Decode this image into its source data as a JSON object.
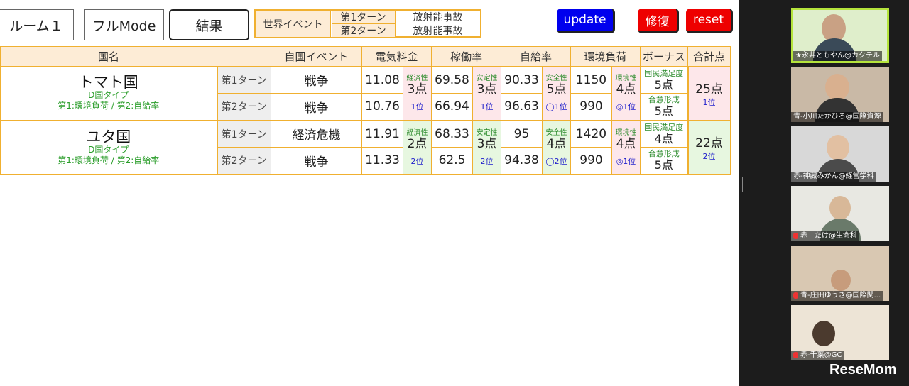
{
  "toolbar": {
    "room_label": "ルーム１",
    "mode_label": "フルMode",
    "result_label": "結果",
    "world_label": "世界イベント",
    "world_turns": [
      {
        "turn": "第1ターン",
        "event": "放射能事故"
      },
      {
        "turn": "第2ターン",
        "event": "放射能事故"
      }
    ],
    "update_label": "update",
    "fix_label": "修復",
    "reset_label": "reset",
    "colors": {
      "update": "#0000ee",
      "fix": "#ee0000",
      "reset": "#ee0000",
      "border": "#f0b030"
    }
  },
  "table": {
    "headers": [
      "国名",
      "",
      "自国イベント",
      "電気料金",
      "稼働率",
      "自給率",
      "環境負荷",
      "ボーナス",
      "合計点"
    ],
    "countries": [
      {
        "name": "トマト国",
        "type": "D国タイプ",
        "priority": "第1:環境負荷 / 第2:自給率",
        "turns": [
          {
            "turn": "第1ターン",
            "event": "戦争",
            "price": "11.08",
            "rate": "69.58",
            "self": "90.33",
            "env": "1150"
          },
          {
            "turn": "第2ターン",
            "event": "戦争",
            "price": "10.76",
            "rate": "66.94",
            "self": "96.63",
            "env": "990"
          }
        ],
        "scores": {
          "price": {
            "title": "経済性",
            "points": "3点",
            "rank": "1位"
          },
          "rate": {
            "title": "安定性",
            "points": "3点",
            "rank": "1位"
          },
          "self": {
            "title": "安全性",
            "points": "5点",
            "rank": "◯1位"
          },
          "env": {
            "title": "環境性",
            "points": "4点",
            "rank": "◎1位"
          }
        },
        "bonus": [
          {
            "title": "国民満足度",
            "points": "5点"
          },
          {
            "title": "合意形成",
            "points": "5点"
          }
        ],
        "total": {
          "points": "25点",
          "rank": "1位"
        }
      },
      {
        "name": "ユタ国",
        "type": "D国タイプ",
        "priority": "第1:環境負荷 / 第2:自給率",
        "turns": [
          {
            "turn": "第1ターン",
            "event": "経済危機",
            "price": "11.91",
            "rate": "68.33",
            "self": "95",
            "env": "1420"
          },
          {
            "turn": "第2ターン",
            "event": "戦争",
            "price": "11.33",
            "rate": "62.5",
            "self": "94.38",
            "env": "990"
          }
        ],
        "scores": {
          "price": {
            "title": "経済性",
            "points": "2点",
            "rank": "2位"
          },
          "rate": {
            "title": "安定性",
            "points": "3点",
            "rank": "2位"
          },
          "self": {
            "title": "安全性",
            "points": "4点",
            "rank": "◯2位"
          },
          "env": {
            "title": "環境性",
            "points": "4点",
            "rank": "◎1位"
          }
        },
        "bonus": [
          {
            "title": "国民満足度",
            "points": "4点"
          },
          {
            "title": "合意形成",
            "points": "5点"
          }
        ],
        "total": {
          "points": "22点",
          "rank": "2位"
        }
      }
    ]
  },
  "participants": [
    {
      "name": "★永井ともやん@カクテル",
      "muted": false
    },
    {
      "name": "青-小川たかひろ@国際資源",
      "muted": false
    },
    {
      "name": "赤-神藏みかん@経営学科",
      "muted": false
    },
    {
      "name": "赤　たけ@生命科",
      "muted": true
    },
    {
      "name": "青-庄田ゆうき@国際関...",
      "muted": true
    },
    {
      "name": "赤-千葉@GC",
      "muted": true
    }
  ],
  "watermark": "ReseMom"
}
